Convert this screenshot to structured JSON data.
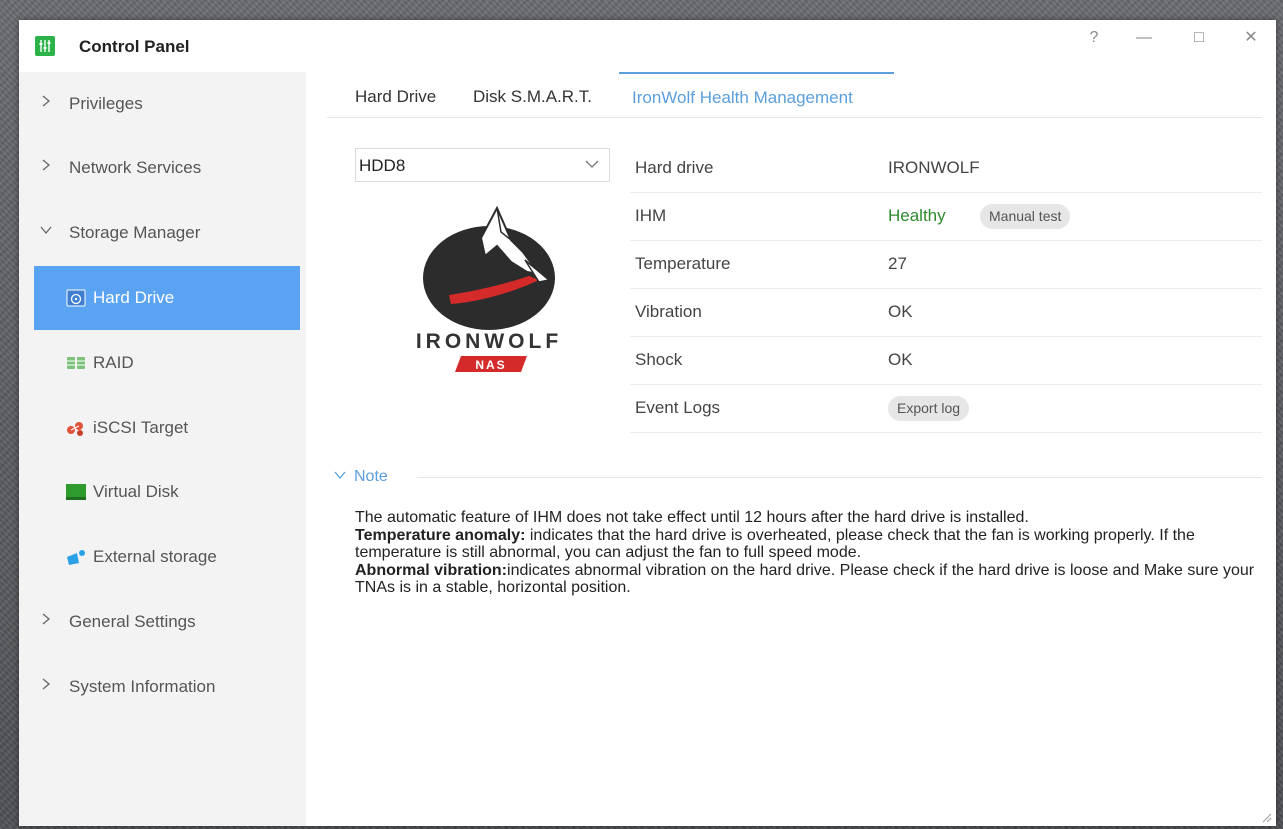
{
  "window": {
    "title": "Control Panel",
    "controls": {
      "help": "?",
      "minimize": "—",
      "maximize": "□",
      "close": "✕"
    }
  },
  "sidebar": {
    "items": [
      {
        "label": "Privileges",
        "state": "collapsed"
      },
      {
        "label": "Network Services",
        "state": "collapsed"
      },
      {
        "label": "Storage Manager",
        "state": "expanded"
      },
      {
        "label": "Hard Drive",
        "icon": "hard-drive-icon",
        "active": true
      },
      {
        "label": "RAID",
        "icon": "raid-icon"
      },
      {
        "label": "iSCSI Target",
        "icon": "iscsi-icon"
      },
      {
        "label": "Virtual Disk",
        "icon": "virtual-disk-icon"
      },
      {
        "label": "External storage",
        "icon": "external-storage-icon"
      },
      {
        "label": "General Settings",
        "state": "collapsed"
      },
      {
        "label": "System Information",
        "state": "collapsed"
      }
    ]
  },
  "tabs": [
    {
      "label": "Hard Drive"
    },
    {
      "label": "Disk S.M.A.R.T."
    },
    {
      "label": "IronWolf Health Management",
      "active": true
    }
  ],
  "drive_select": {
    "value": "HDD8"
  },
  "logo": {
    "brand": "IRONWOLF",
    "badge": "NAS"
  },
  "info": [
    {
      "label": "Hard drive",
      "value": "IRONWOLF"
    },
    {
      "label": "IHM",
      "value": "Healthy",
      "button": "Manual test"
    },
    {
      "label": "Temperature",
      "value": "27"
    },
    {
      "label": "Vibration",
      "value": "OK"
    },
    {
      "label": "Shock",
      "value": "OK"
    },
    {
      "label": "Event Logs",
      "button": "Export log"
    }
  ],
  "note": {
    "label": "Note",
    "line1": "The automatic feature of IHM does not take effect until 12 hours after the hard drive is installed.",
    "temp_title": "Temperature anomaly:",
    "temp_text": " indicates that the hard drive is overheated, please check that the fan is working properly. If the temperature is still abnormal, you can adjust the fan to full speed mode.",
    "vib_title": "Abnormal vibration:",
    "vib_text": "indicates abnormal vibration on the hard drive. Please check if the hard drive is loose and Make sure your TNAs is in a stable, horizontal position."
  },
  "colors": {
    "accent": "#5b9fdd",
    "active_nav": "#5aa3f2",
    "healthy": "#2e8b2e",
    "app_icon": "#2bb34a"
  }
}
